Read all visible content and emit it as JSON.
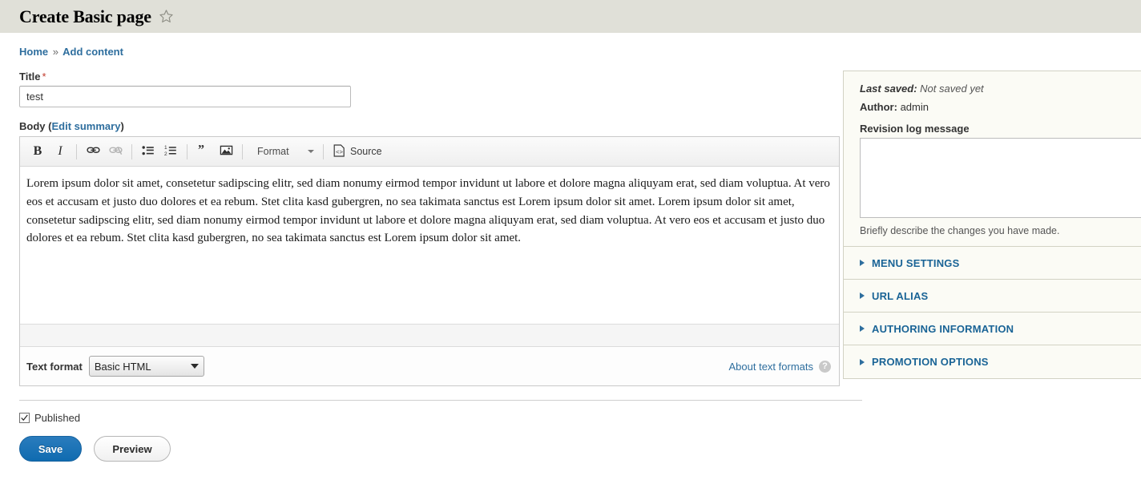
{
  "header": {
    "title": "Create Basic page",
    "star_icon": "star-outline-icon"
  },
  "breadcrumb": {
    "home": "Home",
    "separator": "»",
    "current": "Add content"
  },
  "form": {
    "title_field": {
      "label": "Title",
      "required_marker": "*",
      "value": "test"
    },
    "body_field": {
      "label": "Body",
      "edit_summary_link": "Edit summary",
      "open_paren": "(",
      "close_paren": ")",
      "content": "Lorem ipsum dolor sit amet, consetetur sadipscing elitr, sed diam nonumy eirmod tempor invidunt ut labore et dolore magna aliquyam erat, sed diam voluptua. At vero eos et accusam et justo duo dolores et ea rebum. Stet clita kasd gubergren, no sea takimata sanctus est Lorem ipsum dolor sit amet. Lorem ipsum dolor sit amet, consetetur sadipscing elitr, sed diam nonumy eirmod tempor invidunt ut labore et dolore magna aliquyam erat, sed diam voluptua. At vero eos et accusam et justo duo dolores et ea rebum. Stet clita kasd gubergren, no sea takimata sanctus est Lorem ipsum dolor sit amet."
    },
    "editor_toolbar": {
      "bold": "B",
      "italic": "I",
      "link_icon": "link-icon",
      "unlink_icon": "unlink-icon",
      "bulleted_list_icon": "bulleted-list-icon",
      "numbered_list_icon": "numbered-list-icon",
      "blockquote_icon": "blockquote-icon",
      "image_icon": "image-icon",
      "format_label": "Format",
      "source_label": "Source",
      "source_icon": "source-code-icon"
    },
    "text_format": {
      "label": "Text format",
      "selected": "Basic HTML",
      "options": [
        "Basic HTML"
      ],
      "about_link": "About text formats",
      "help_icon": "question-mark-icon",
      "help_glyph": "?"
    },
    "published": {
      "label": "Published",
      "checked": true
    },
    "buttons": {
      "save": "Save",
      "preview": "Preview"
    }
  },
  "sidebar": {
    "last_saved": {
      "key": "Last saved:",
      "value": "Not saved yet"
    },
    "author": {
      "key": "Author:",
      "value": "admin"
    },
    "revision_log": {
      "label": "Revision log message",
      "value": "",
      "description": "Briefly describe the changes you have made."
    },
    "accordion": [
      {
        "label": "MENU SETTINGS"
      },
      {
        "label": "URL ALIAS"
      },
      {
        "label": "AUTHORING INFORMATION"
      },
      {
        "label": "PROMOTION OPTIONS"
      }
    ]
  },
  "colors": {
    "header_band": "#e0e0d8",
    "link_blue": "#2e6e9e",
    "accent_blue": "#1a6496",
    "save_button": "#0f6bb0",
    "required_red": "#c0392b",
    "sidebar_bg": "#fbfbf5"
  }
}
